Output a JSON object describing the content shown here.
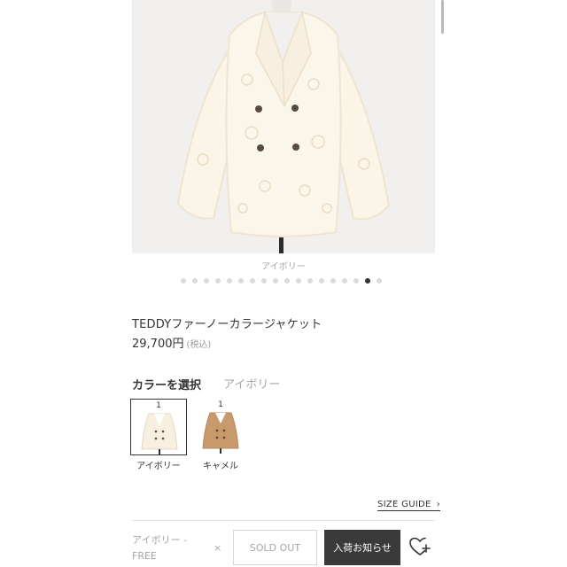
{
  "image": {
    "caption": "アイボリー",
    "slide_count": 18,
    "active_slide": 16
  },
  "product": {
    "name": "TEDDYファーノーカラージャケット",
    "price": "29,700円",
    "tax_note": "(税込)"
  },
  "color": {
    "heading": "カラーを選択",
    "selected_name": "アイボリー",
    "options": [
      {
        "label": "アイボリー",
        "stock": "1",
        "color": "#f6efe2",
        "selected": true
      },
      {
        "label": "キャメル",
        "stock": "1",
        "color": "#c99a6c",
        "selected": false
      }
    ]
  },
  "size_guide": {
    "label": "SIZE GUIDE"
  },
  "cart": {
    "variant": "アイボリー - FREE",
    "remove": "×",
    "sold_out": "SOLD OUT",
    "notify": "入荷お知らせ"
  },
  "icons": {
    "wishlist": "heart-plus-icon",
    "size_guide_arrow": "chevron-right-icon"
  }
}
